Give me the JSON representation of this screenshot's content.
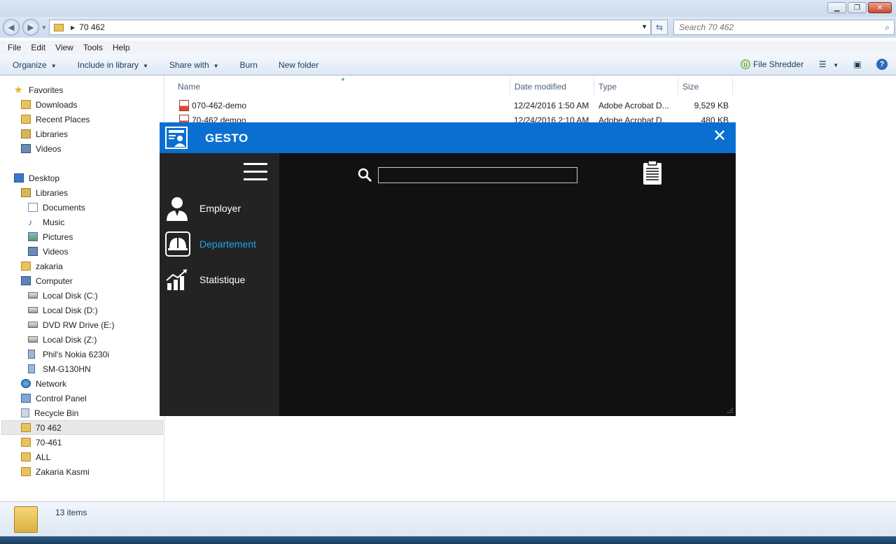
{
  "explorer": {
    "window_buttons": {
      "minimize": "▁",
      "maximize": "❐",
      "close": "✕"
    },
    "address": {
      "path": "70 462"
    },
    "search": {
      "placeholder": "Search 70 462"
    },
    "menu": [
      "File",
      "Edit",
      "View",
      "Tools",
      "Help"
    ],
    "commands": {
      "organize": "Organize",
      "include_in_library": "Include in library",
      "share_with": "Share with",
      "burn": "Burn",
      "new_folder": "New folder",
      "file_shredder": "File Shredder"
    },
    "nav": [
      {
        "label": "Favorites",
        "icon": "star-icon"
      },
      {
        "label": "Downloads",
        "icon": "downloads-folder-icon"
      },
      {
        "label": "Recent Places",
        "icon": "recent-places-icon"
      },
      {
        "label": "Libraries",
        "icon": "libraries-icon"
      },
      {
        "label": "Videos",
        "icon": "videos-icon"
      },
      {
        "label": "Desktop",
        "icon": "desktop-icon"
      },
      {
        "label": "Libraries",
        "icon": "libraries-icon"
      },
      {
        "label": "Documents",
        "icon": "documents-icon"
      },
      {
        "label": "Music",
        "icon": "music-icon"
      },
      {
        "label": "Pictures",
        "icon": "pictures-icon"
      },
      {
        "label": "Videos",
        "icon": "videos-icon"
      },
      {
        "label": "zakaria",
        "icon": "user-folder-icon"
      },
      {
        "label": "Computer",
        "icon": "computer-icon"
      },
      {
        "label": "Local Disk (C:)",
        "icon": "disk-icon"
      },
      {
        "label": "Local Disk (D:)",
        "icon": "disk-icon"
      },
      {
        "label": "DVD RW Drive (E:)",
        "icon": "dvd-drive-icon"
      },
      {
        "label": "Local Disk (Z:)",
        "icon": "disk-icon"
      },
      {
        "label": "Phil's Nokia 6230i",
        "icon": "phone-icon"
      },
      {
        "label": "SM-G130HN",
        "icon": "phone-icon"
      },
      {
        "label": "Network",
        "icon": "network-icon"
      },
      {
        "label": "Control Panel",
        "icon": "control-panel-icon"
      },
      {
        "label": "Recycle Bin",
        "icon": "recycle-bin-icon"
      },
      {
        "label": "70 462",
        "icon": "folder-icon"
      },
      {
        "label": "70-461",
        "icon": "folder-icon"
      },
      {
        "label": "ALL",
        "icon": "folder-icon"
      },
      {
        "label": "Zakaria Kasmi",
        "icon": "folder-icon"
      }
    ],
    "columns": {
      "name": "Name",
      "date_modified": "Date modified",
      "type": "Type",
      "size": "Size"
    },
    "files": [
      {
        "name": "070-462-demo",
        "date": "12/24/2016 1:50 AM",
        "type": "Adobe Acrobat D...",
        "size": "9,529 KB"
      },
      {
        "name": "70-462 demoo",
        "date": "12/24/2016 2:10 AM",
        "type": "Adobe Acrobat D...",
        "size": "480 KB"
      }
    ],
    "status": {
      "items": "13 items"
    }
  },
  "gesto": {
    "title": "GESTO",
    "close": "✕",
    "nav": [
      {
        "label": "Employer",
        "icon": "employee-icon"
      },
      {
        "label": "Departement",
        "icon": "department-helmet-icon"
      },
      {
        "label": "Statistique",
        "icon": "statistics-chart-icon"
      }
    ],
    "search": {
      "value": ""
    },
    "colors": {
      "titlebar": "#0a6fd1",
      "sidebar": "#232323",
      "content": "#111111",
      "active": "#1aa7e8"
    }
  }
}
